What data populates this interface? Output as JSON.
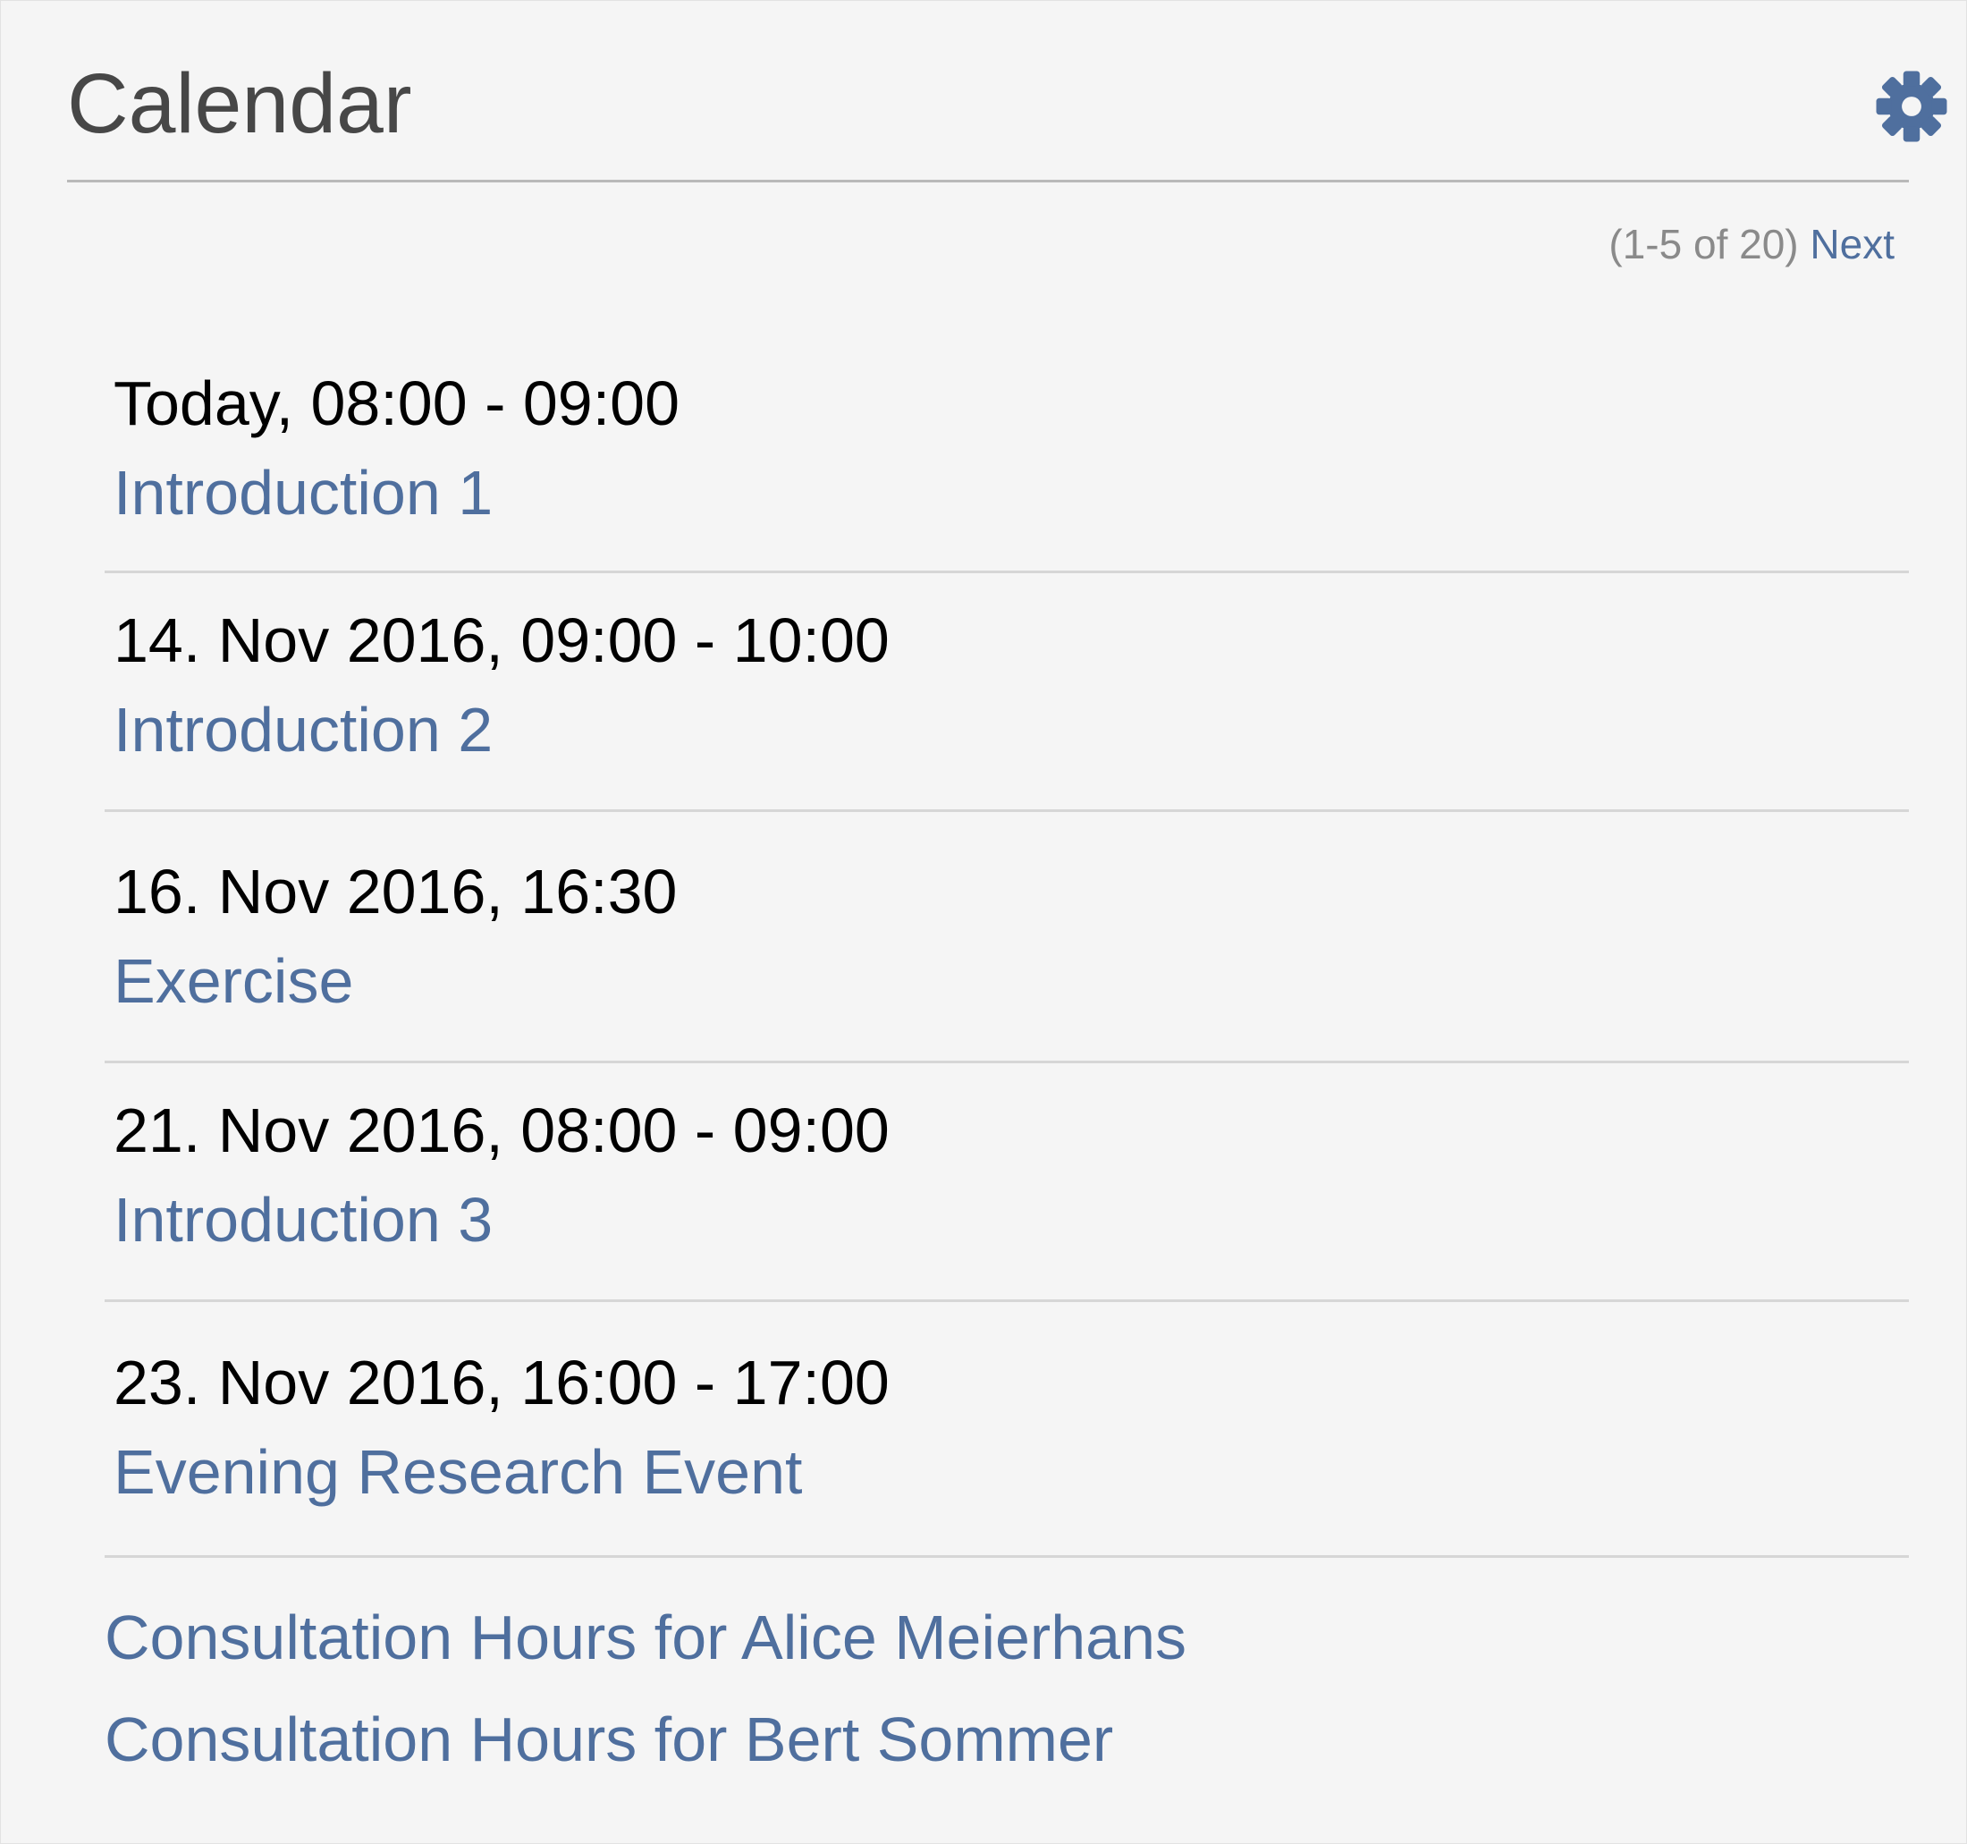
{
  "calendar": {
    "title": "Calendar",
    "settings_icon": "gear-icon",
    "pager": {
      "count": "(1-5 of 20)",
      "next_label": "Next"
    },
    "events": [
      {
        "time": "Today, 08:00 - 09:00",
        "title": "Introduction 1"
      },
      {
        "time": "14. Nov 2016, 09:00 - 10:00",
        "title": "Introduction 2"
      },
      {
        "time": "16. Nov 2016, 16:30",
        "title": "Exercise"
      },
      {
        "time": "21. Nov 2016, 08:00 - 09:00",
        "title": "Introduction 3"
      },
      {
        "time": "23. Nov 2016, 16:00 - 17:00",
        "title": "Evening Research Event"
      }
    ],
    "consultation_links": [
      "Consultation Hours for Alice Meierhans",
      "Consultation Hours for Bert Sommer"
    ]
  },
  "colors": {
    "background": "#f5f5f5",
    "title": "#474747",
    "link": "#4f6f9e",
    "muted": "#8a8a8a",
    "divider": "#d6d6d6"
  }
}
